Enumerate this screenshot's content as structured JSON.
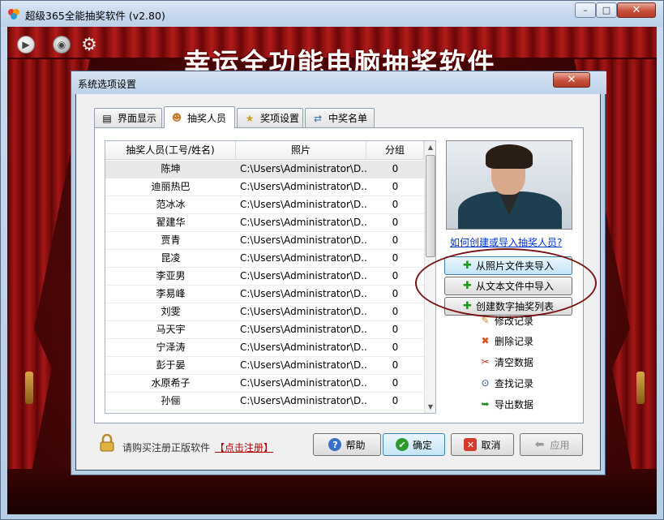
{
  "window": {
    "title": "超级365全能抽奖软件 (v2.80)",
    "controls": {
      "minimize": "–",
      "maximize": "□",
      "close": "✕"
    }
  },
  "stage": {
    "title": "幸运全功能电脑抽奖软件",
    "toolbar_icons": [
      "play-icon",
      "sound-icon",
      "gear-icon"
    ]
  },
  "dialog": {
    "title": "系统选项设置",
    "close": "✕",
    "tabs": [
      {
        "label": "界面显示",
        "icon": "display-icon",
        "active": false
      },
      {
        "label": "抽奖人员",
        "icon": "person-icon",
        "active": true
      },
      {
        "label": "奖项设置",
        "icon": "prize-icon",
        "active": false
      },
      {
        "label": "中奖名单",
        "icon": "winner-list-icon",
        "active": false
      }
    ],
    "table": {
      "columns": [
        "抽奖人员(工号/姓名)",
        "照片",
        "分组"
      ],
      "rows": [
        {
          "name": "陈坤",
          "photo": "C:\\Users\\Administrator\\D...",
          "group": "0"
        },
        {
          "name": "迪丽热巴",
          "photo": "C:\\Users\\Administrator\\D...",
          "group": "0"
        },
        {
          "name": "范冰冰",
          "photo": "C:\\Users\\Administrator\\D...",
          "group": "0"
        },
        {
          "name": "翟建华",
          "photo": "C:\\Users\\Administrator\\D...",
          "group": "0"
        },
        {
          "name": "贾青",
          "photo": "C:\\Users\\Administrator\\D...",
          "group": "0"
        },
        {
          "name": "昆凌",
          "photo": "C:\\Users\\Administrator\\D...",
          "group": "0"
        },
        {
          "name": "李亚男",
          "photo": "C:\\Users\\Administrator\\D...",
          "group": "0"
        },
        {
          "name": "李易峰",
          "photo": "C:\\Users\\Administrator\\D...",
          "group": "0"
        },
        {
          "name": "刘雯",
          "photo": "C:\\Users\\Administrator\\D...",
          "group": "0"
        },
        {
          "name": "马天宇",
          "photo": "C:\\Users\\Administrator\\D...",
          "group": "0"
        },
        {
          "name": "宁泽涛",
          "photo": "C:\\Users\\Administrator\\D...",
          "group": "0"
        },
        {
          "name": "彭于晏",
          "photo": "C:\\Users\\Administrator\\D...",
          "group": "0"
        },
        {
          "name": "水原希子",
          "photo": "C:\\Users\\Administrator\\D...",
          "group": "0"
        },
        {
          "name": "孙俪",
          "photo": "C:\\Users\\Administrator\\D...",
          "group": "0"
        }
      ],
      "selected_row": 0
    },
    "import_help_link": "如何创建或导入抽奖人员?",
    "import_buttons": {
      "photo_folder": "从照片文件夹导入",
      "text_file": "从文本文件中导入",
      "number_list": "创建数字抽奖列表"
    },
    "actions": {
      "edit": "修改记录",
      "delete": "删除记录",
      "clear": "清空数据",
      "find": "查找记录",
      "export": "导出数据"
    },
    "footer": {
      "register_text": "请购买注册正版软件",
      "register_link": "【点击注册】",
      "help": "帮助",
      "ok": "确定",
      "cancel": "取消",
      "apply": "应用"
    }
  },
  "colors": {
    "curtain_red": "#a51616",
    "stage_dark": "#4d0606",
    "link_blue": "#0033cc",
    "register_red": "#b00000",
    "highlight_ellipse": "#7a1414"
  }
}
